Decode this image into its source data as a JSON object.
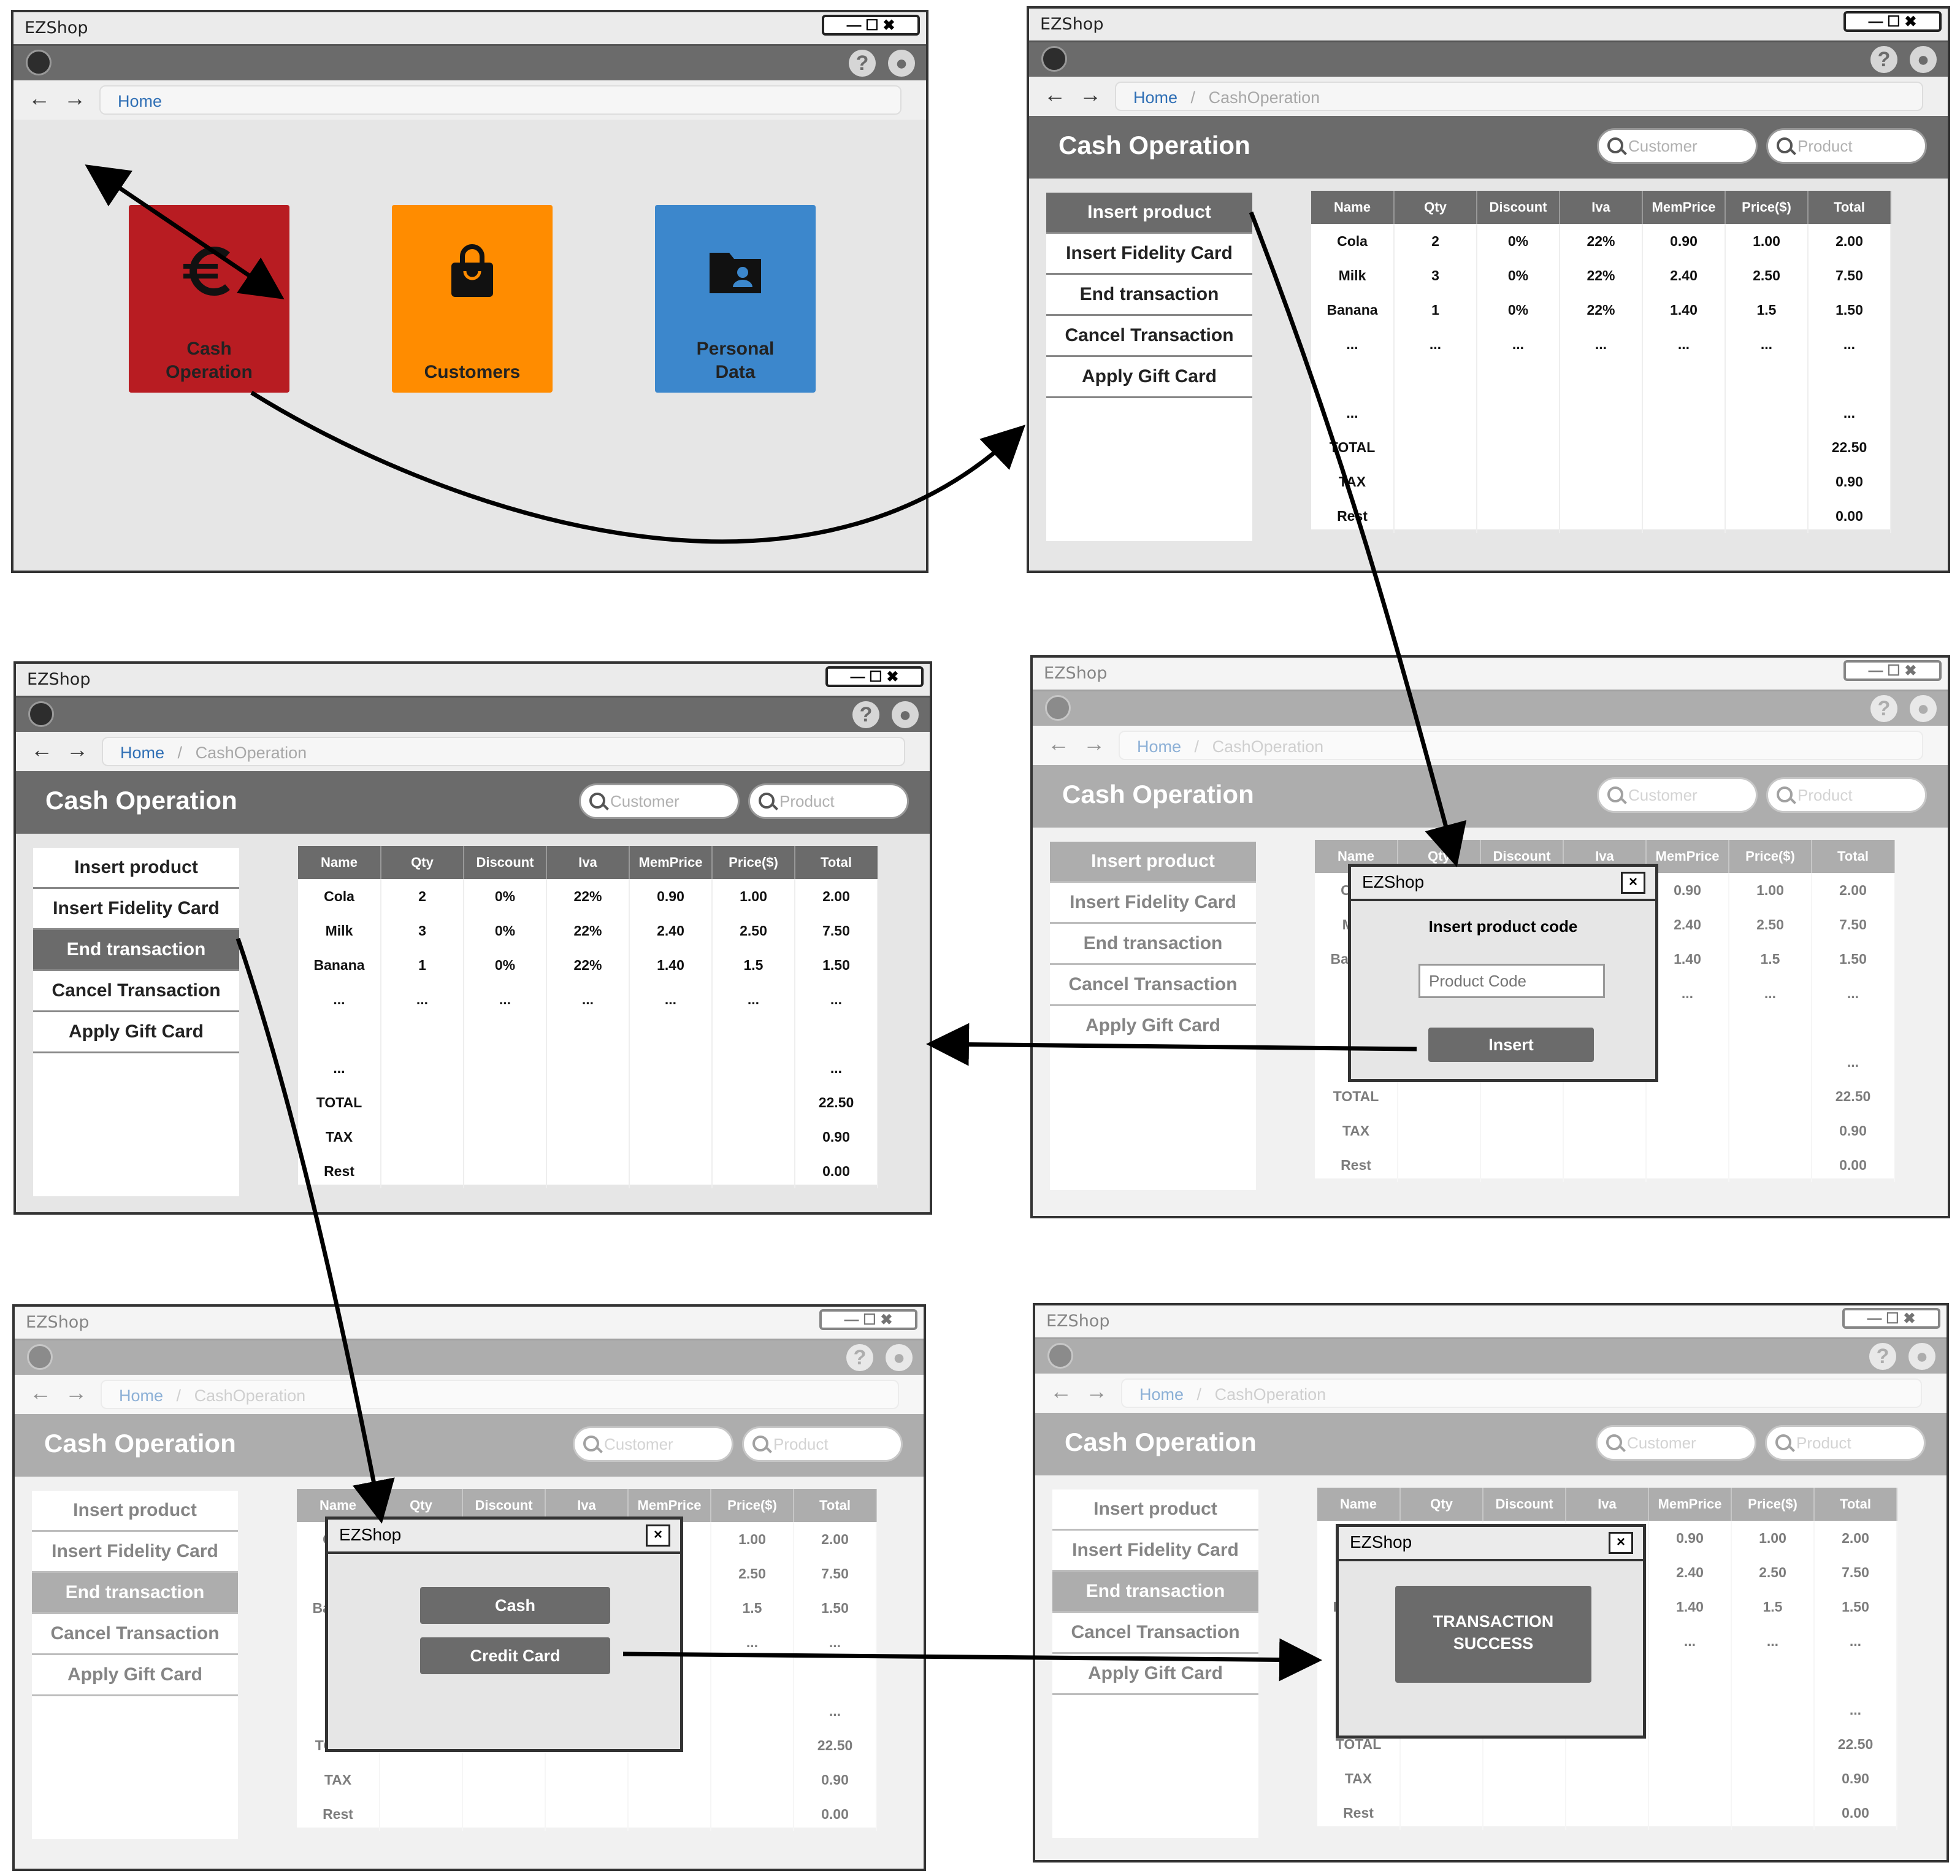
{
  "app": {
    "title": "EZShop",
    "window_controls": "— ☐ ✖",
    "help": "?",
    "user": "●",
    "back": "←",
    "forward": "→",
    "breadcrumb_home": "Home",
    "breadcrumb_sep": "/",
    "breadcrumb_current": "CashOperation"
  },
  "home": {
    "tiles": [
      {
        "label": "Cash\nOperation",
        "color": "#b81c22",
        "icon": "euro-icon"
      },
      {
        "label": "Customers",
        "color": "#ff8c00",
        "icon": "shopping-bag-icon"
      },
      {
        "label": "Personal\nData",
        "color": "#3c87cc",
        "icon": "folder-user-icon"
      }
    ]
  },
  "cash": {
    "title": "Cash Operation",
    "search_customer": "Customer",
    "search_product": "Product",
    "menu": [
      "Insert product",
      "Insert Fidelity Card",
      "End transaction",
      "Cancel Transaction",
      "Apply Gift Card"
    ],
    "columns": [
      "Name",
      "Qty",
      "Discount",
      "Iva",
      "MemPrice",
      "Price($)",
      "Total"
    ],
    "rows": [
      [
        "Cola",
        "2",
        "0%",
        "22%",
        "0.90",
        "1.00",
        "2.00"
      ],
      [
        "Milk",
        "3",
        "0%",
        "22%",
        "2.40",
        "2.50",
        "7.50"
      ],
      [
        "Banana",
        "1",
        "0%",
        "22%",
        "1.40",
        "1.5",
        "1.50"
      ],
      [
        "...",
        "...",
        "...",
        "...",
        "...",
        "...",
        "..."
      ],
      [
        "",
        "",
        "",
        "",
        "",
        "",
        ""
      ],
      [
        "...",
        "",
        "",
        "",
        "",
        "",
        "..."
      ],
      [
        "TOTAL",
        "",
        "",
        "",
        "",
        "",
        "22.50"
      ],
      [
        "TAX",
        "",
        "",
        "",
        "",
        "",
        "0.90"
      ],
      [
        "Rest",
        "",
        "",
        "",
        "",
        "",
        "0.00"
      ]
    ]
  },
  "dialogs": {
    "insert": {
      "title": "EZShop",
      "close": "×",
      "heading": "Insert product code",
      "placeholder": "Product Code",
      "button": "Insert"
    },
    "payment": {
      "title": "EZShop",
      "close": "×",
      "cash": "Cash",
      "card": "Credit Card"
    },
    "success": {
      "title": "EZShop",
      "close": "×",
      "message": "TRANSACTION\nSUCCESS"
    }
  }
}
